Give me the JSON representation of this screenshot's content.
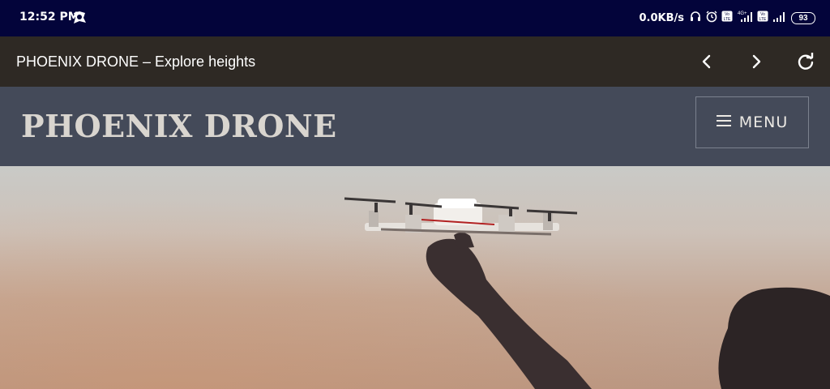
{
  "status_bar": {
    "time": "12:52 PM",
    "network_speed": "0.0KB/s",
    "battery": "93",
    "icons": [
      "notification-app-icon",
      "headphones-icon",
      "alarm-icon",
      "volte-icon",
      "signal-4g-icon",
      "volte-icon",
      "signal-icon",
      "battery-icon"
    ]
  },
  "app_bar": {
    "title": "PHOENIX DRONE – Explore heights",
    "icons": [
      "back-icon",
      "forward-icon",
      "refresh-icon"
    ]
  },
  "site": {
    "title": "PHOENIX DRONE",
    "menu_label": "MENU"
  },
  "colors": {
    "status_bar_bg": "#03043a",
    "app_bar_bg": "#2e2924",
    "header_bg": "#444a59",
    "site_title": "#d9d5cf"
  }
}
